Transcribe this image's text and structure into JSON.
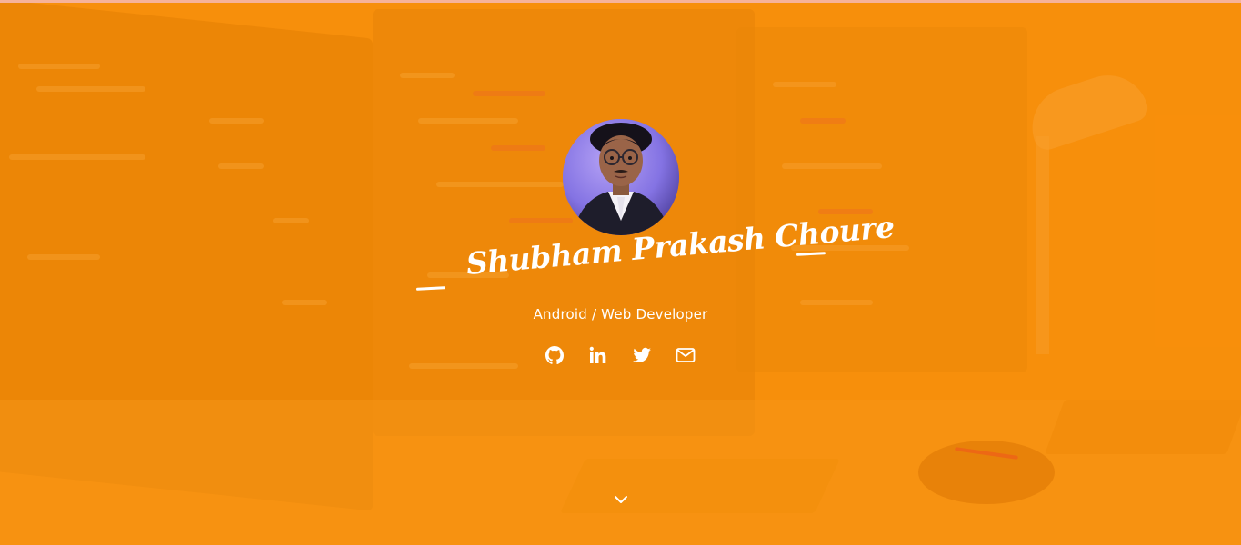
{
  "hero": {
    "name": "Shubham Prakash Choure",
    "subtitle": "Android / Web Developer",
    "accent_color": "#f5900f",
    "text_color": "#ffffff"
  },
  "avatar": {
    "icon": "profile-photo"
  },
  "socials": [
    {
      "icon": "github-icon"
    },
    {
      "icon": "linkedin-icon"
    },
    {
      "icon": "twitter-icon"
    },
    {
      "icon": "mail-icon"
    }
  ],
  "scroll": {
    "icon": "chevron-down-icon"
  }
}
